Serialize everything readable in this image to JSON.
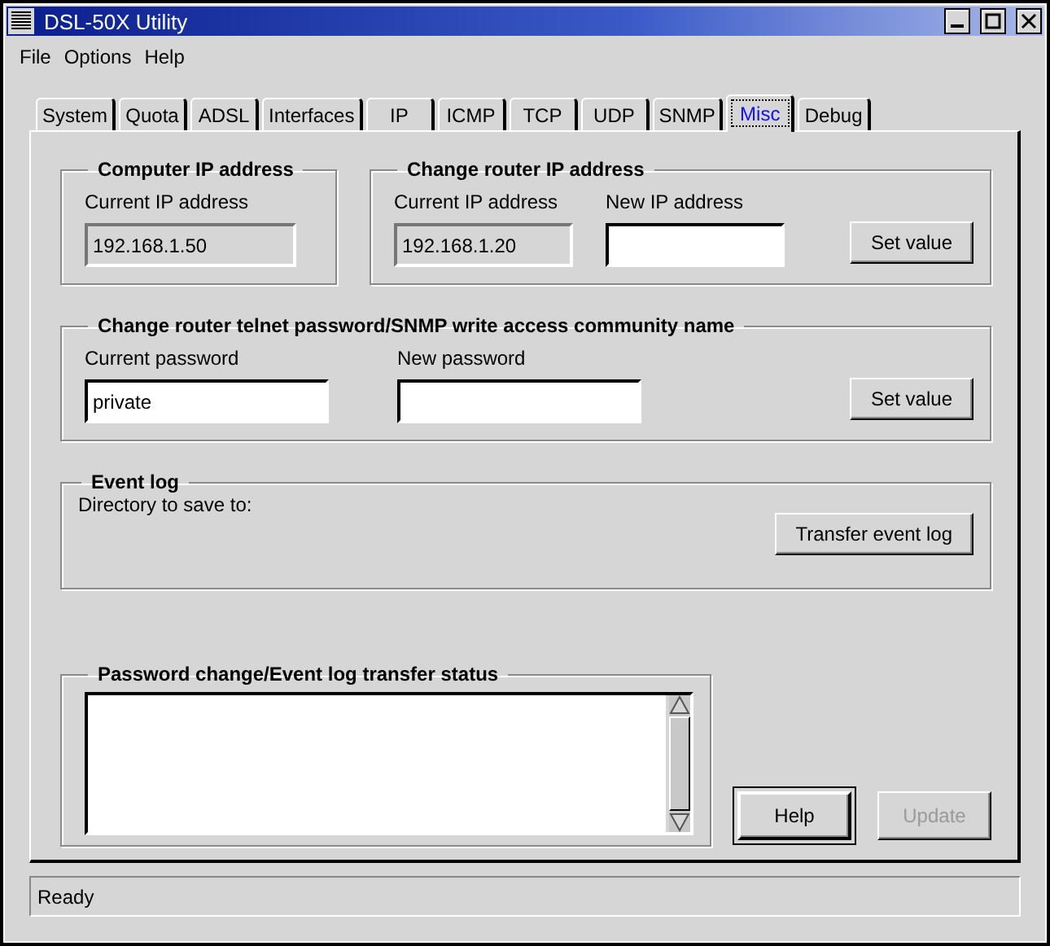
{
  "window": {
    "title": "DSL-50X Utility"
  },
  "menu": [
    "File",
    "Options",
    "Help"
  ],
  "tabs": [
    {
      "label": "System",
      "selected": false
    },
    {
      "label": "Quota",
      "selected": false
    },
    {
      "label": "ADSL",
      "selected": false
    },
    {
      "label": "Interfaces",
      "selected": false
    },
    {
      "label": "IP",
      "selected": false
    },
    {
      "label": "ICMP",
      "selected": false
    },
    {
      "label": "TCP",
      "selected": false
    },
    {
      "label": "UDP",
      "selected": false
    },
    {
      "label": "SNMP",
      "selected": false
    },
    {
      "label": "Misc",
      "selected": true
    },
    {
      "label": "Debug",
      "selected": false
    }
  ],
  "computer_ip": {
    "title": "Computer IP address",
    "fields": [
      {
        "label": "Current IP address",
        "value": "192.168.1.50",
        "read_only": true
      }
    ]
  },
  "router_ip": {
    "title": "Change router IP address",
    "fields": [
      {
        "label": "Current IP address",
        "value": "192.168.1.20",
        "read_only": true
      },
      {
        "label": "New IP address",
        "read_only": false
      }
    ],
    "button": "Set value"
  },
  "password": {
    "title": "Change router telnet password/SNMP write access community name",
    "fields": [
      {
        "label": "Current password",
        "value": "private",
        "read_only": false
      },
      {
        "label": "New password",
        "read_only": false
      }
    ],
    "button": "Set value"
  },
  "event_log": {
    "title": "Event log",
    "directory_label": "Directory to save to:",
    "button": "Transfer event log"
  },
  "status_log": {
    "title": "Password change/Event log transfer status"
  },
  "buttons": [
    {
      "label": "Help",
      "default": true,
      "disabled": false
    },
    {
      "label": "Update",
      "default": false,
      "disabled": true
    }
  ],
  "status_bar": "Ready"
}
